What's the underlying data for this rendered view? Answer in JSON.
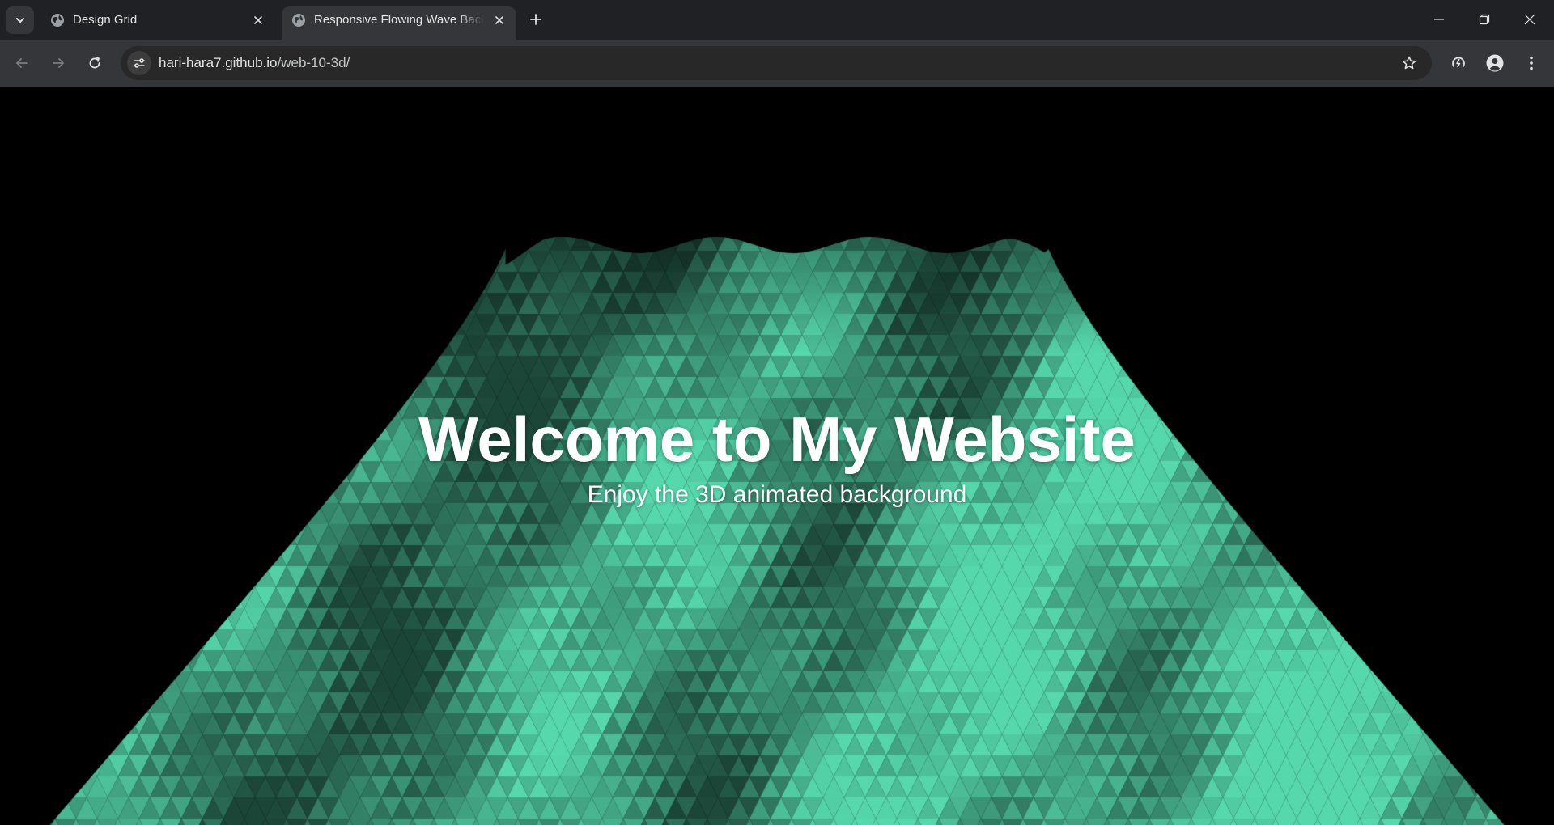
{
  "browser": {
    "tabs": [
      {
        "title": "Design Grid",
        "active": false,
        "favicon": "globe-icon"
      },
      {
        "title": "Responsive Flowing Wave Background",
        "active": true,
        "favicon": "globe-icon"
      }
    ],
    "url": {
      "host": "hari-hara7.github.io",
      "path": "/web-10-3d/"
    },
    "colors": {
      "tabstrip_bg": "#202124",
      "toolbar_bg": "#35363a",
      "omnibox_bg": "#282828",
      "icon_color": "#e3e3e3"
    }
  },
  "page": {
    "title": "Welcome to My Website",
    "subtitle": "Enjoy the 3D animated background",
    "background_color": "#000000",
    "wave_color": "#4ec49c"
  }
}
